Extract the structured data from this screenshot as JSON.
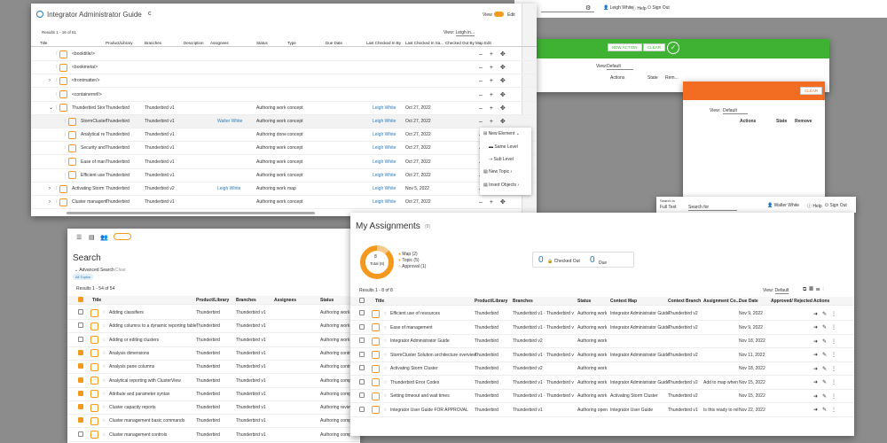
{
  "topbar": {
    "user": "Leigh White",
    "help": "Help",
    "signout": "Sign Out"
  },
  "w1": {
    "title": "Integrator Administrator Guide",
    "view_label": "View",
    "edit_label": "Edit",
    "results": "Results 1 - 16 of 51",
    "view_select": "Leigh in...",
    "cols": [
      "Title",
      "Product/Library",
      "Branches",
      "Description",
      "Assignees",
      "Status",
      "Type",
      "Due Date",
      "Last Checked In By",
      "Last Checked In Sa...",
      "Checked Out By",
      "Map Edit"
    ],
    "rows": [
      {
        "title": "<booktitle/>",
        "lib": "",
        "br": "",
        "as": "",
        "st": "",
        "ty": "",
        "by": "",
        "dt": ""
      },
      {
        "title": "<bookmeta/>",
        "lib": "",
        "br": "",
        "as": "",
        "st": "",
        "ty": "",
        "by": "",
        "dt": ""
      },
      {
        "title": "<frontmatter/>",
        "lib": "",
        "br": "",
        "as": "",
        "st": "",
        "ty": "",
        "by": "",
        "dt": ""
      },
      {
        "title": "<containerref/>",
        "lib": "",
        "br": "",
        "as": "",
        "st": "",
        "ty": "",
        "by": "",
        "dt": ""
      },
      {
        "title": "Thunderbird Stor",
        "lib": "Thunderbird",
        "br": "Thunderbird v1",
        "as": "",
        "st": "Authoring work",
        "ty": "concept",
        "by": "Leigh White",
        "dt": "Oct 27, 2022"
      },
      {
        "title": "StormCluster",
        "lib": "Thunderbird",
        "br": "Thunderbird v1",
        "as": "Walter White",
        "st": "Authoring work",
        "ty": "concept",
        "by": "Leigh White",
        "dt": "Oct 27, 2022"
      },
      {
        "title": "Analytical re",
        "lib": "Thunderbird",
        "br": "Thunderbird v1",
        "as": "",
        "st": "Authoring done",
        "ty": "concept",
        "by": "Leigh White",
        "dt": "Oct 27, 2022"
      },
      {
        "title": "Security and",
        "lib": "Thunderbird",
        "br": "Thunderbird v1",
        "as": "",
        "st": "Authoring work",
        "ty": "concept",
        "by": "Leigh White",
        "dt": "Oct 27, 2022"
      },
      {
        "title": "Ease of man",
        "lib": "Thunderbird",
        "br": "Thunderbird v1",
        "as": "",
        "st": "Authoring work",
        "ty": "concept",
        "by": "Leigh White",
        "dt": "Oct 27, 2022"
      },
      {
        "title": "Efficient use",
        "lib": "Thunderbird",
        "br": "Thunderbird v1",
        "as": "",
        "st": "Authoring work",
        "ty": "concept",
        "by": "Leigh White",
        "dt": "Oct 27, 2022"
      },
      {
        "title": "Activating Storm",
        "lib": "Thunderbird",
        "br": "Thunderbird v2",
        "as": "Leigh White",
        "st": "Authoring work",
        "ty": "map",
        "by": "Leigh White",
        "dt": "Nov 5, 2022"
      },
      {
        "title": "Cluster managem",
        "lib": "Thunderbird",
        "br": "Thunderbird v1",
        "as": "",
        "st": "Authoring work",
        "ty": "concept",
        "by": "Leigh White",
        "dt": "Oct 27, 2022"
      }
    ],
    "menu": [
      "New Element",
      "Same Level",
      "Sub Level",
      "New Topic",
      "Insert Objects"
    ]
  },
  "w2": {
    "new_action": "NEW ACTION",
    "clear": "CLEAR",
    "view": "View:",
    "view_val": "Default",
    "cols": [
      "Actions",
      "State",
      "Rem..."
    ]
  },
  "w3": {
    "clear": "CLEAR",
    "view": "View:",
    "view_val": "Default",
    "cols": [
      "Actions",
      "State",
      "Remove"
    ]
  },
  "w4": {
    "search_in": "Search in",
    "full_text": "Full Text",
    "search_for": "Search for",
    "user": "Walter White",
    "help": "Help",
    "signout": "Sign Out"
  },
  "search": {
    "title": "Search",
    "advanced": "Advanced Search",
    "clear": "Clear",
    "chip": "All Topics",
    "results": "Results 1 - 54 of 54",
    "cols": [
      "Title",
      "Product/Library",
      "Branches",
      "Assignees",
      "Status"
    ],
    "rows": [
      {
        "t": "Adding classifiers",
        "l": "Thunderbird",
        "b": "Thunderbird v1",
        "s": "Authoring work",
        "c": false
      },
      {
        "t": "Adding columns to a dynamic reporting table",
        "l": "Thunderbird",
        "b": "Thunderbird v1",
        "s": "Authoring work",
        "c": false
      },
      {
        "t": "Adding or editing clusters",
        "l": "Thunderbird",
        "b": "Thunderbird v1",
        "s": "Authoring work",
        "c": false
      },
      {
        "t": "Analysis dimensions",
        "l": "Thunderbird",
        "b": "Thunderbird v1",
        "s": "Authoring contrib",
        "c": true
      },
      {
        "t": "Analysis pane columns",
        "l": "Thunderbird",
        "b": "Thunderbird v1",
        "s": "Authoring contrib",
        "c": true
      },
      {
        "t": "Analytical reporting with ClusterView",
        "l": "Thunderbird",
        "b": "Thunderbird v1",
        "s": "Authoring complet",
        "c": true
      },
      {
        "t": "Attribute and parameter syntax",
        "l": "Thunderbird",
        "b": "Thunderbird v1",
        "s": "Authoring complet",
        "c": true
      },
      {
        "t": "Cluster capacity reports",
        "l": "Thunderbird",
        "b": "Thunderbird v1",
        "s": "Authoring review",
        "c": true
      },
      {
        "t": "Cluster management basic commands",
        "l": "Thunderbird",
        "b": "Thunderbird v1",
        "s": "Authoring complet",
        "c": true
      },
      {
        "t": "Cluster management controls",
        "l": "Thunderbird",
        "b": "Thunderbird v1",
        "s": "Authoring complet",
        "c": false
      }
    ]
  },
  "assign": {
    "title": "My Assignments",
    "count": "(8)",
    "total_num": "8",
    "total_lbl": "Total (8)",
    "legend": [
      "Map (2)",
      "Topic (5)",
      "Approval (1)"
    ],
    "checked_out_num": "0",
    "checked_out_lbl": "Checked Out",
    "due_num": "0",
    "due_lbl": "Due",
    "results": "Results 1 - 8 of 8",
    "view": "View:",
    "view_val": "Default",
    "cols": [
      "Title",
      "Product/Library",
      "Branches",
      "Status",
      "Context Map",
      "Context Branch",
      "Assignment Co...",
      "Due Date",
      "Approved/ Rejected",
      "Actions"
    ],
    "rows": [
      {
        "t": "Efficient use of resources",
        "l": "Thunderbird",
        "b": "Thunderbird v1 · Thunderbird v",
        "s": "Authoring work",
        "m": "Integrator Administrator Guide",
        "cb": "Thunderbird v2",
        "ac": "",
        "d": "Nov 9, 2022"
      },
      {
        "t": "Ease of management",
        "l": "Thunderbird",
        "b": "Thunderbird v1 · Thunderbird v",
        "s": "Authoring work",
        "m": "Integrator Administrator Guide",
        "cb": "Thunderbird v2",
        "ac": "",
        "d": "Nov 9, 2022"
      },
      {
        "t": "Integrator Administrator Guide",
        "l": "Thunderbird",
        "b": "Thunderbird v2",
        "s": "Authoring work",
        "m": "",
        "cb": "",
        "ac": "",
        "d": "Nov 18, 2022"
      },
      {
        "t": "StormCluster Solution architecture overview",
        "l": "Thunderbird",
        "b": "Thunderbird v1 · Thunderbird v",
        "s": "Authoring work",
        "m": "Integrator Administrator Guide",
        "cb": "Thunderbird v2",
        "ac": "",
        "d": "Nov 11, 2022"
      },
      {
        "t": "Activating Storm Cluster",
        "l": "Thunderbird",
        "b": "Thunderbird v2",
        "s": "Authoring work",
        "m": "",
        "cb": "",
        "ac": "",
        "d": "Nov 18, 2022"
      },
      {
        "t": "Thunderbird Error Codes",
        "l": "Thunderbird",
        "b": "Thunderbird v1 · Thunderbird v",
        "s": "Authoring work",
        "m": "Integrator Administrator Guide",
        "cb": "Thunderbird v2",
        "ac": "Add to map when",
        "d": "Nov 15, 2022"
      },
      {
        "t": "Setting timeout and wait times",
        "l": "Thunderbird",
        "b": "Thunderbird v1 · Thunderbird v",
        "s": "Authoring work",
        "m": "Activating Storm Cluster",
        "cb": "Thunderbird v2",
        "ac": "",
        "d": "Nov 15, 2022"
      },
      {
        "t": "Integrator User Guide FOR APPROVAL",
        "l": "Thunderbird",
        "b": "Thunderbird v1",
        "s": "Authoring open",
        "m": "Integrator User Guide",
        "cb": "Thunderbird v1",
        "ac": "Is this ready to rel",
        "d": "Nov 22, 2022"
      }
    ]
  },
  "colors": {
    "accent": "#f39a1e",
    "green": "#3fb233",
    "orange": "#f26d21",
    "link": "#2a7ab8"
  }
}
